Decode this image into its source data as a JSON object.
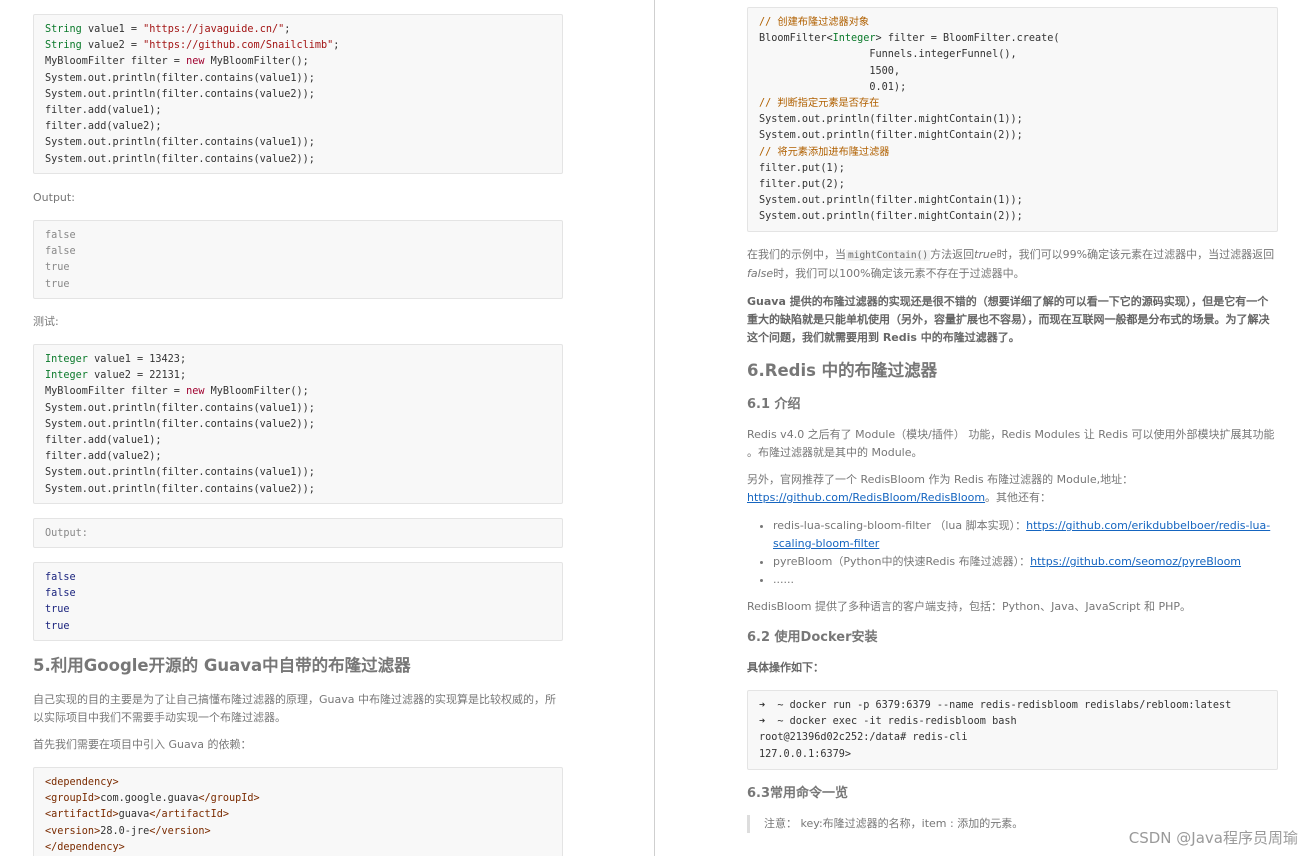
{
  "left": {
    "code1": [
      [
        [
          "String",
          "kw"
        ],
        [
          " value1 = ",
          ""
        ],
        [
          "\"https://javaguide.cn/\"",
          "str"
        ],
        [
          ";",
          ""
        ]
      ],
      [
        [
          "String",
          "kw"
        ],
        [
          " value2 = ",
          ""
        ],
        [
          "\"https://github.com/Snailclimb\"",
          "str"
        ],
        [
          ";",
          ""
        ]
      ],
      [
        [
          "MyBloomFilter filter = ",
          ""
        ],
        [
          "new",
          "new"
        ],
        [
          " MyBloomFilter();",
          ""
        ]
      ],
      [
        [
          "System.out.println(filter.contains(value1));",
          ""
        ]
      ],
      [
        [
          "System.out.println(filter.contains(value2));",
          ""
        ]
      ],
      [
        [
          "filter.add(value1);",
          ""
        ]
      ],
      [
        [
          "filter.add(value2);",
          ""
        ]
      ],
      [
        [
          "System.out.println(filter.contains(value1));",
          ""
        ]
      ],
      [
        [
          "System.out.println(filter.contains(value2));",
          ""
        ]
      ]
    ],
    "output_label_1": "Output:",
    "output1": [
      [
        [
          "false",
          "plain"
        ]
      ],
      [
        [
          "false",
          "plain"
        ]
      ],
      [
        [
          "true",
          "plain"
        ]
      ],
      [
        [
          "true",
          "plain"
        ]
      ]
    ],
    "test_label": "测试:",
    "code2": [
      [
        [
          "Integer",
          "kw"
        ],
        [
          " value1 = 13423;",
          ""
        ]
      ],
      [
        [
          "Integer",
          "kw"
        ],
        [
          " value2 = 22131;",
          ""
        ]
      ],
      [
        [
          "MyBloomFilter filter = ",
          ""
        ],
        [
          "new",
          "new"
        ],
        [
          " MyBloomFilter();",
          ""
        ]
      ],
      [
        [
          "System.out.println(filter.contains(value1));",
          ""
        ]
      ],
      [
        [
          "System.out.println(filter.contains(value2));",
          ""
        ]
      ],
      [
        [
          "filter.add(value1);",
          ""
        ]
      ],
      [
        [
          "filter.add(value2);",
          ""
        ]
      ],
      [
        [
          "System.out.println(filter.contains(value1));",
          ""
        ]
      ],
      [
        [
          "System.out.println(filter.contains(value2));",
          ""
        ]
      ]
    ],
    "output_block_2": [
      [
        [
          "Output:",
          "plain"
        ]
      ]
    ],
    "output2": [
      [
        [
          "false",
          "kwb"
        ]
      ],
      [
        [
          "false",
          "kwb"
        ]
      ],
      [
        [
          "true",
          "kwb"
        ]
      ],
      [
        [
          "true",
          "kwb"
        ]
      ]
    ],
    "heading_5": "5.利用Google开源的 Guava中自带的布隆过滤器",
    "para_5_1": "自己实现的目的主要是为了让自己搞懂布隆过滤器的原理，Guava 中布隆过滤器的实现算是比较权威的，所以实际项目中我们不需要手动实现一个布隆过滤器。",
    "para_5_2": "首先我们需要在项目中引入 Guava 的依赖：",
    "code3": [
      [
        [
          "<dependency>",
          "tag"
        ]
      ],
      [
        [
          "<groupId>",
          "tag"
        ],
        [
          "com.google.guava",
          ""
        ],
        [
          "</groupId>",
          "tag"
        ]
      ],
      [
        [
          "<artifactId>",
          "tag"
        ],
        [
          "guava",
          ""
        ],
        [
          "</artifactId>",
          "tag"
        ]
      ],
      [
        [
          "<version>",
          "tag"
        ],
        [
          "28.0-jre",
          ""
        ],
        [
          "</version>",
          "tag"
        ]
      ],
      [
        [
          "</dependency>",
          "tag"
        ]
      ]
    ]
  },
  "right": {
    "code4": [
      [
        [
          "// 创建布隆过滤器对象",
          "cm"
        ]
      ],
      [
        [
          "BloomFilter<",
          ""
        ],
        [
          "Integer",
          "kw"
        ],
        [
          "> filter = BloomFilter.create(",
          ""
        ]
      ],
      [
        [
          "                  Funnels.integerFunnel(),",
          ""
        ]
      ],
      [
        [
          "                  1500,",
          ""
        ]
      ],
      [
        [
          "                  0.01);",
          ""
        ]
      ],
      [
        [
          "// 判断指定元素是否存在",
          "cm"
        ]
      ],
      [
        [
          "System.out.println(filter.mightContain(1));",
          ""
        ]
      ],
      [
        [
          "System.out.println(filter.mightContain(2));",
          ""
        ]
      ],
      [
        [
          "// 将元素添加进布隆过滤器",
          "cm"
        ]
      ],
      [
        [
          "filter.put(1);",
          ""
        ]
      ],
      [
        [
          "filter.put(2);",
          ""
        ]
      ],
      [
        [
          "System.out.println(filter.mightContain(1));",
          ""
        ]
      ],
      [
        [
          "System.out.println(filter.mightContain(2));",
          ""
        ]
      ]
    ],
    "para_r1": {
      "a": "在我们的示例中，当",
      "code": "mightContain()",
      "b": "方法返回",
      "true_word": "true",
      "c": "时，我们可以99%确定该元素在过滤器中，当过滤器返回",
      "false_word": "false",
      "d": "时，我们可以100%确定该元素不存在于过滤器中。"
    },
    "para_r2": "Guava 提供的布隆过滤器的实现还是很不错的（想要详细了解的可以看一下它的源码实现），但是它有一个重大的缺陷就是只能单机使用（另外，容量扩展也不容易），而现在互联网一般都是分布式的场景。为了解决这个问题，我们就需要用到 Redis 中的布隆过滤器了。",
    "heading_6": "6.Redis 中的布隆过滤器",
    "heading_6_1": "6.1 介绍",
    "para_6_1": "Redis v4.0 之后有了 Module（模块/插件） 功能，Redis Modules 让 Redis 可以使用外部模块扩展其功能 。布隆过滤器就是其中的 Module。",
    "para_6_2_prefix": "另外，官网推荐了一个 RedisBloom  作为 Redis 布隆过滤器的 Module,地址：",
    "para_6_2_link": "https://github.com/RedisBloom/RedisBloom",
    "para_6_2_suffix": "。其他还有：",
    "list": [
      {
        "text": "redis-lua-scaling-bloom-filter （lua 脚本实现）：",
        "link": "https://github.com/erikdubbelboer/redis-lua-scaling-bloom-filter"
      },
      {
        "text": "pyreBloom（Python中的快速Redis 布隆过滤器）：",
        "link": "https://github.com/seomoz/pyreBloom"
      },
      {
        "text": "......",
        "link": ""
      }
    ],
    "para_6_3": "RedisBloom 提供了多种语言的客户端支持，包括：Python、Java、JavaScript 和 PHP。",
    "heading_6_2": "6.2 使用Docker安装",
    "steps_label": "具体操作如下：",
    "code5": [
      [
        [
          "➜  ~ docker run -p 6379:6379 --name redis-redisbloom redislabs/rebloom:latest",
          ""
        ]
      ],
      [
        [
          "➜  ~ docker exec -it redis-redisbloom bash",
          ""
        ]
      ],
      [
        [
          "root@21396d02c252:/data# redis-cli",
          ""
        ]
      ],
      [
        [
          "127.0.0.1:6379>",
          ""
        ]
      ]
    ],
    "heading_6_3": "6.3常用命令一览",
    "note": "注意： key:布隆过滤器的名称，item : 添加的元素。"
  },
  "watermark": "CSDN @Java程序员周瑜"
}
